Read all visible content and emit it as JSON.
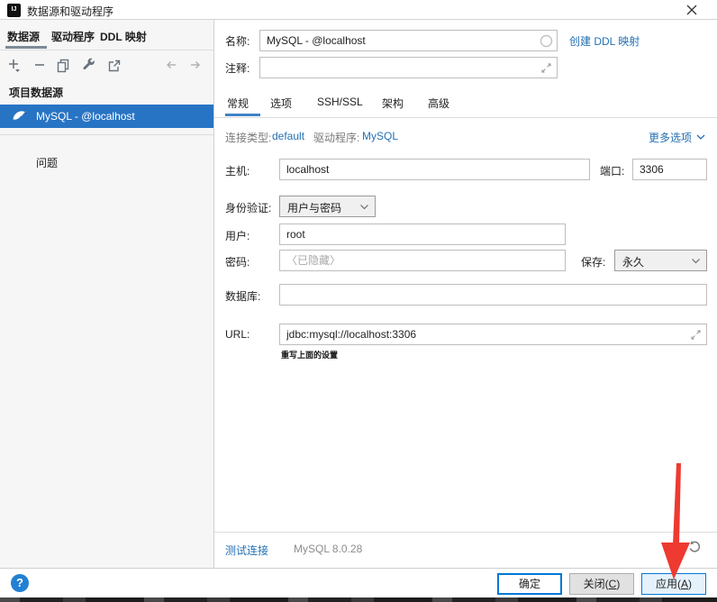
{
  "window": {
    "title": "数据源和驱动程序",
    "app_badge": "IJ"
  },
  "left_panel": {
    "tabs": [
      "数据源",
      "驱动程序",
      "DDL 映射"
    ],
    "selected_tab": "数据源",
    "tree": {
      "group_label": "项目数据源",
      "selected_item": "MySQL - @localhost",
      "problems_label": "问题"
    }
  },
  "form": {
    "name": {
      "label": "名称:",
      "value": "MySQL - @localhost"
    },
    "create_ddl_link": "创建 DDL 映射",
    "comment": {
      "label": "注释:",
      "value": ""
    },
    "tabs": [
      "常规",
      "选项",
      "SSH/SSL",
      "架构",
      "高级"
    ],
    "selected_tab": "常规",
    "connection_type": {
      "label": "连接类型:",
      "value": "default"
    },
    "driver": {
      "label": "驱动程序:",
      "value": "MySQL"
    },
    "more_options": "更多选项",
    "host": {
      "label": "主机:",
      "value": "localhost"
    },
    "port": {
      "label": "端口:",
      "value": "3306"
    },
    "auth": {
      "label": "身份验证:",
      "value": "用户与密码"
    },
    "user": {
      "label": "用户:",
      "value": "root"
    },
    "password": {
      "label": "密码:",
      "placeholder": "〈已隐藏〉"
    },
    "save": {
      "label": "保存:",
      "value": "永久"
    },
    "database": {
      "label": "数据库:",
      "value": ""
    },
    "url": {
      "label": "URL:",
      "value": "jdbc:mysql://localhost:3306",
      "hint": "重写上面的设置"
    }
  },
  "status_bar": {
    "test_connection": "测试连接",
    "driver_version": "MySQL 8.0.28"
  },
  "footer": {
    "ok": "确定",
    "close_prefix": "关闭(",
    "close_mnemonic": "C",
    "close_suffix": ")",
    "apply_prefix": "应用(",
    "apply_mnemonic": "A",
    "apply_suffix": ")"
  },
  "colors": {
    "selection_blue": "#2874c4",
    "link_blue": "#2470b3",
    "tab_underline_blue": "#4083c9",
    "arrow_red": "#ee3a30",
    "apply_bg": "#e5f1fb",
    "button_border_blue": "#0078d7"
  }
}
